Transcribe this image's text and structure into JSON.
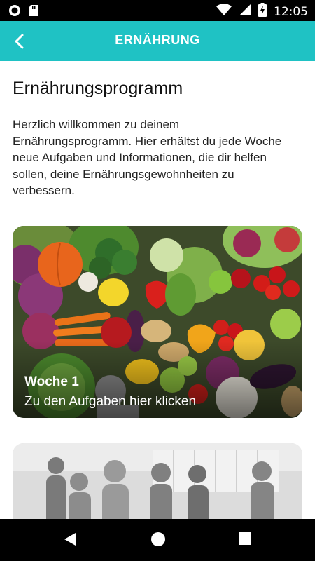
{
  "status_bar": {
    "time": "12:05",
    "icons": [
      "circle-notification-icon",
      "sd-card-icon",
      "wifi-icon",
      "signal-icon",
      "battery-charging-icon"
    ]
  },
  "app_bar": {
    "title": "ERNÄHRUNG",
    "back_icon": "chevron-left-icon",
    "color": "#1fc2c4"
  },
  "main": {
    "title": "Ernährungsprogramm",
    "intro": "Herzlich willkommen zu deinem Ernährungsprogramm. Hier erhältst du jede Woche neue Aufgaben und Informationen, die dir helfen sollen, deine Ernährungsgewohnheiten zu verbessern.",
    "cards": [
      {
        "week": "Woche 1",
        "subtitle": "Zu den Aufgaben hier klicken",
        "image": "vegetables-image"
      },
      {
        "week": "",
        "subtitle": "",
        "image": "fitness-group-image"
      }
    ]
  },
  "nav_bar": {
    "icons": [
      "back-triangle-icon",
      "home-circle-icon",
      "recents-square-icon"
    ]
  }
}
